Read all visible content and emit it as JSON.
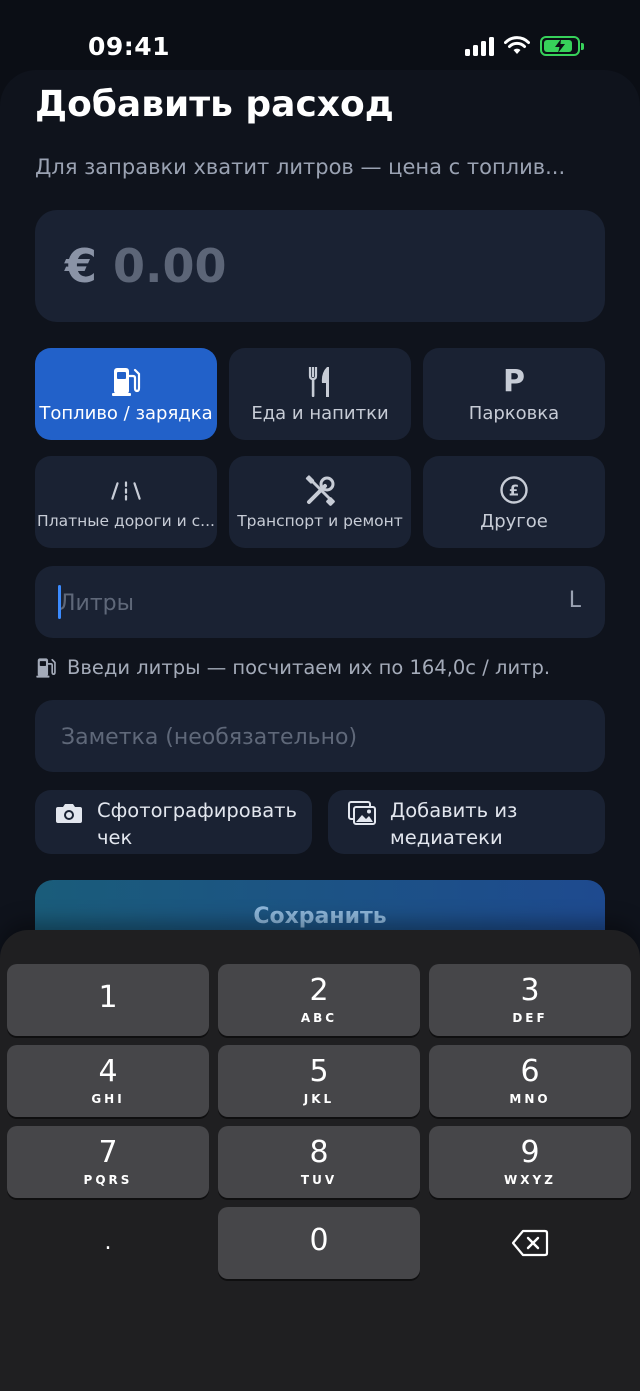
{
  "status": {
    "time": "09:41"
  },
  "title": "Добавить расход",
  "subtitle": "Для заправки хватит литров — цена с топлив...",
  "amount": {
    "currency": "€",
    "value": "0.00"
  },
  "categories": [
    {
      "label": "Топливо / зарядка",
      "icon": "fuel-pump-icon",
      "active": true
    },
    {
      "label": "Еда и напитки",
      "icon": "fork-knife-icon",
      "active": false
    },
    {
      "label": "Парковка",
      "icon": "parking-icon",
      "active": false
    },
    {
      "label": "Платные дороги и с...",
      "icon": "toll-road-icon",
      "active": false
    },
    {
      "label": "Транспорт и ремонт",
      "icon": "tools-icon",
      "active": false
    },
    {
      "label": "Другое",
      "icon": "pound-coin-icon",
      "active": false
    }
  ],
  "parking_glyph": "P",
  "liters": {
    "placeholder": "Литры",
    "unit": "L"
  },
  "hint": "Введи литры — посчитаем их по 164,0c / литр.",
  "note": {
    "placeholder": "Заметка (необязательно)"
  },
  "media": {
    "camera_label": "Сфотографировать\nчек",
    "library_label": "Добавить из\nмедиатеки"
  },
  "save_label": "Сохранить",
  "keyboard": {
    "keys": [
      {
        "digit": "1",
        "letters": ""
      },
      {
        "digit": "2",
        "letters": "ABC"
      },
      {
        "digit": "3",
        "letters": "DEF"
      },
      {
        "digit": "4",
        "letters": "GHI"
      },
      {
        "digit": "5",
        "letters": "JKL"
      },
      {
        "digit": "6",
        "letters": "MNO"
      },
      {
        "digit": "7",
        "letters": "PQRS"
      },
      {
        "digit": "8",
        "letters": "TUV"
      },
      {
        "digit": "9",
        "letters": "WXYZ"
      },
      {
        "digit": ".",
        "letters": ""
      },
      {
        "digit": "0",
        "letters": ""
      }
    ]
  },
  "colors": {
    "accent": "#2261c9",
    "field_bg": "#1a2233",
    "battery": "#37d15a"
  }
}
